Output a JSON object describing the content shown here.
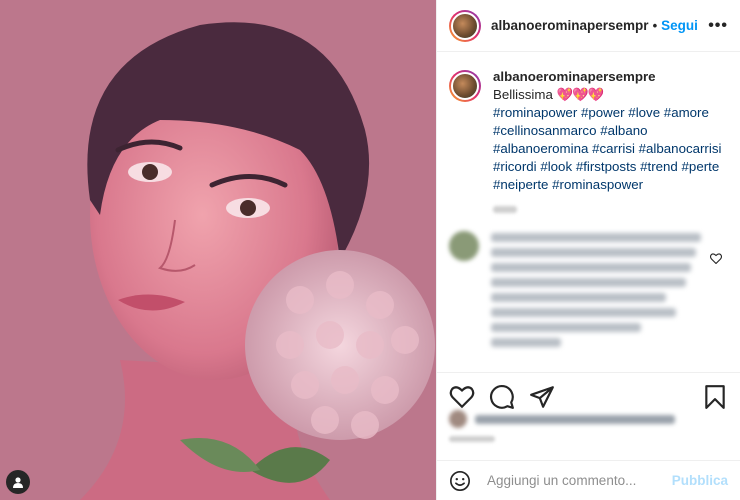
{
  "header": {
    "username": "albanoerominapersempr",
    "separator": "•",
    "follow_label": "Segui",
    "more_label": "•••"
  },
  "caption": {
    "username": "albanoerominapersempre",
    "text": "Bellissima",
    "emoji": "💖💖💖",
    "hashtags": [
      "#rominapower",
      "#power",
      "#love",
      "#amore",
      "#cellinosanmarco",
      "#albano",
      "#albanoeromina",
      "#carrisi",
      "#albanocarrisi",
      "#ricordi",
      "#look",
      "#firstposts",
      "#trend",
      "#perte",
      "#neiperte",
      "#rominaspower"
    ]
  },
  "comment_form": {
    "placeholder": "Aggiungi un commento...",
    "submit_label": "Pubblica"
  },
  "icons": {
    "like": "heart-icon",
    "comment": "comment-icon",
    "share": "share-icon",
    "save": "bookmark-icon",
    "emoji": "emoji-icon",
    "user_tag": "user-icon"
  },
  "colors": {
    "accent": "#0095f6",
    "hashtag": "#00376b",
    "publish_disabled": "#b2dffc"
  }
}
